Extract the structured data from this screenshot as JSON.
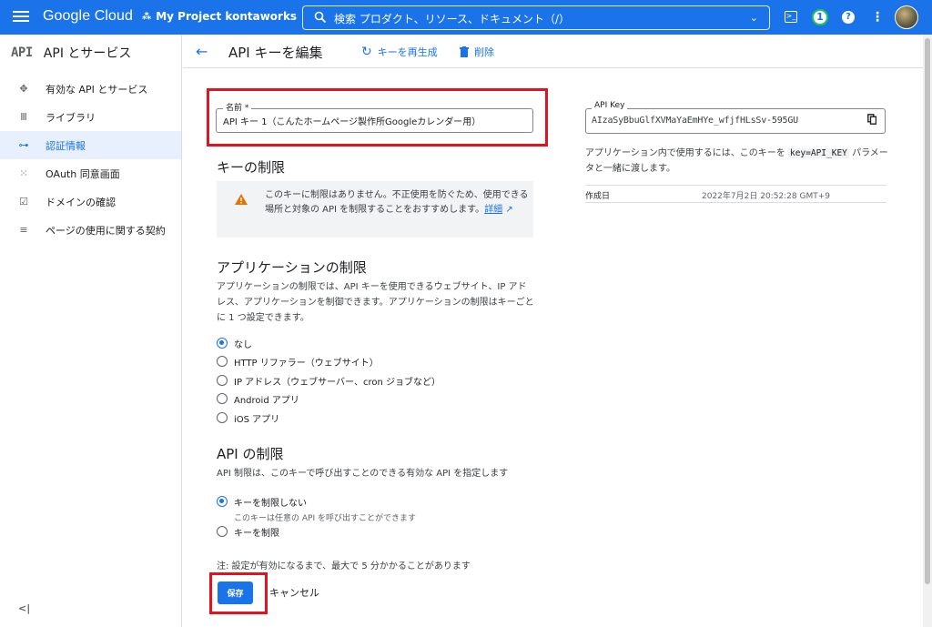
{
  "topbar": {
    "brand": "Google Cloud",
    "project": "My Project kontaworks",
    "search_placeholder": "検索  プロダクト、リソース、ドキュメント（/）",
    "notification_count": "1"
  },
  "sidebar": {
    "logo": "API",
    "title": "API とサービス",
    "items": [
      {
        "label": "有効な API とサービス",
        "icon": "api-hub-icon"
      },
      {
        "label": "ライブラリ",
        "icon": "library-icon"
      },
      {
        "label": "認証情報",
        "icon": "key-icon",
        "active": true
      },
      {
        "label": "OAuth 同意画面",
        "icon": "oauth-icon"
      },
      {
        "label": "ドメインの確認",
        "icon": "checkbox-icon"
      },
      {
        "label": "ページの使用に関する契約",
        "icon": "settings-list-icon"
      }
    ],
    "collapse": "<|"
  },
  "header": {
    "title": "API キーを編集",
    "regenerate": "キーを再生成",
    "delete": "削除"
  },
  "form": {
    "name_label": "名前 *",
    "name_value": "API キー 1（こんたホームページ製作所Googleカレンダー用）",
    "key_restrictions_title": "キーの制限",
    "warning_text": "このキーに制限はありません。不正使用を防ぐため、使用できる場所と対象の API を制限することをおすすめします。",
    "warning_link": "詳細",
    "app_restrictions_title": "アプリケーションの制限",
    "app_restrictions_desc": "アプリケーションの制限では、API キーを使用できるウェブサイト、IP アドレス、アプリケーションを制御できます。アプリケーションの制限はキーごとに 1 つ設定できます。",
    "app_options": [
      "なし",
      "HTTP リファラー（ウェブサイト）",
      "IP アドレス（ウェブサーバー、cron ジョブなど）",
      "Android アプリ",
      "iOS アプリ"
    ],
    "api_restrictions_title": "API の制限",
    "api_restrictions_desc": "API 制限は、このキーで呼び出すことのできる有効な API を指定します",
    "api_option_none": "キーを制限しない",
    "api_option_none_sub": "このキーは任意の API を呼び出すことができます",
    "api_option_restrict": "キーを制限",
    "note": "注: 設定が有効になるまで、最大で 5 分かかることがあります",
    "save": "保存",
    "cancel": "キャンセル"
  },
  "key_panel": {
    "label": "API Key",
    "value": "AIzaSyBbuGlfXVMaYaEmHYe_wfjfHLsSv-595GU",
    "desc_before": "アプリケーション内で使用するには、このキーを ",
    "desc_code": "key=API_KEY",
    "desc_after": " パラメータと一緒に渡します。",
    "created_label": "作成日",
    "created_value": "2022年7月2日 20:52:28 GMT+9"
  }
}
